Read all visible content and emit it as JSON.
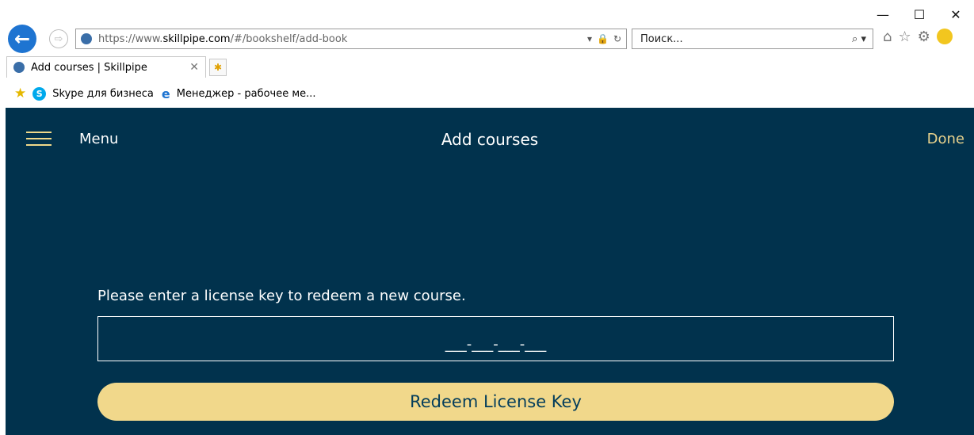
{
  "browser": {
    "window_controls": {
      "minimize": "—",
      "maximize": "☐",
      "close": "✕"
    },
    "address_bar": {
      "url_prefix": "https://www.",
      "url_domain": "skillpipe.com",
      "url_path": "/#/bookshelf/add-book"
    },
    "search": {
      "placeholder": "Поиск..."
    },
    "tab": {
      "title": "Add courses | Skillpipe"
    },
    "favorites": [
      {
        "label": "Skype для бизнеса",
        "icon": "skype-icon"
      },
      {
        "label": "Менеджер - рабочее ме...",
        "icon": "ie-icon"
      }
    ]
  },
  "app": {
    "header": {
      "menu_label": "Menu",
      "title": "Add courses",
      "done_label": "Done"
    },
    "form": {
      "prompt": "Please enter a license key to redeem a new course.",
      "license_placeholder": "___-___-___-___",
      "redeem_label": "Redeem License Key"
    },
    "colors": {
      "background": "#01324d",
      "accent": "#f1d88b",
      "button_text": "#033d5b"
    }
  }
}
